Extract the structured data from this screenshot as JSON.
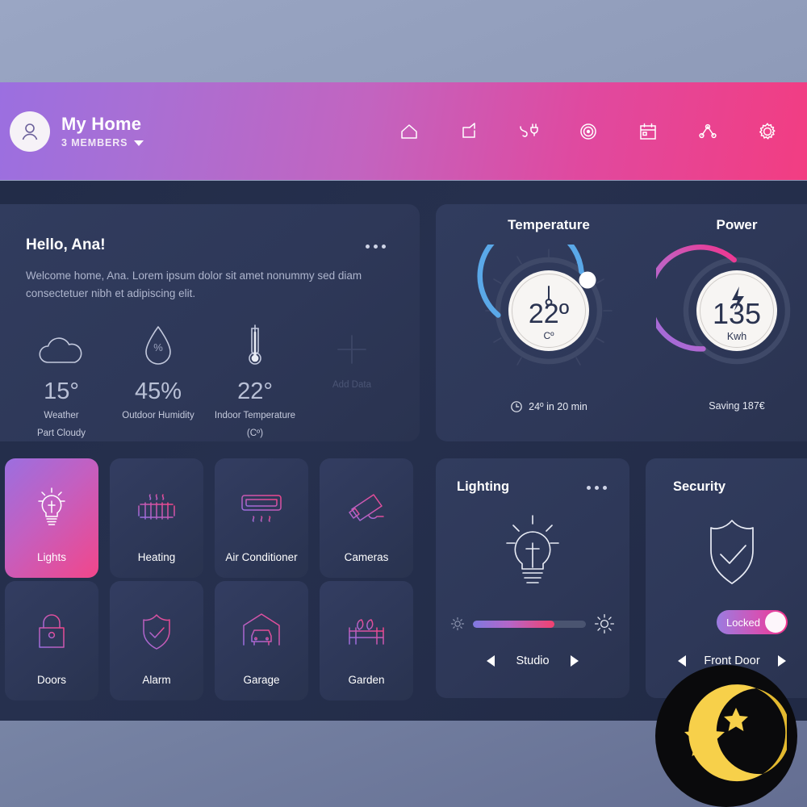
{
  "header": {
    "home_name": "My Home",
    "members": "3 MEMBERS",
    "avatar_icon": "user-avatar-icon",
    "caret_icon": "chevron-down-icon",
    "nav": [
      {
        "name": "home-icon",
        "label": "Home"
      },
      {
        "name": "share-box-icon",
        "label": "Rooms"
      },
      {
        "name": "plug-icon",
        "label": "Devices"
      },
      {
        "name": "target-icon",
        "label": "Scenes"
      },
      {
        "name": "calendar-icon",
        "label": "Schedule"
      },
      {
        "name": "network-nodes-icon",
        "label": "Automation"
      },
      {
        "name": "gear-icon",
        "label": "Settings"
      }
    ],
    "gradient_from": "#9b6fe0",
    "gradient_to": "#f23d82"
  },
  "hello": {
    "title": "Hello, Ana!",
    "body": "Welcome home, Ana. Lorem ipsum dolor sit amet nonummy sed diam consectetuer nibh et adipiscing elit.",
    "menu_icon": "more-options-icon",
    "stats": [
      {
        "icon": "cloud-icon",
        "value": "15°",
        "label": "Weather",
        "label2": "Part Cloudy"
      },
      {
        "icon": "humidity-drop-icon",
        "value": "45%",
        "label": "Outdoor Humidity",
        "label2": ""
      },
      {
        "icon": "thermometer-icon",
        "value": "22°",
        "label": "Indoor Temperature",
        "label2": "(Cº)"
      },
      {
        "icon": "plus-icon",
        "value": "",
        "label": "Add Data",
        "label2": ""
      }
    ]
  },
  "gauges": {
    "temperature": {
      "title": "Temperature",
      "value": "22º",
      "unit": "Cº",
      "footer": "24º in 20 min",
      "footer_icon": "clock-icon",
      "dial_icon": "thermometer-needle-icon",
      "arc_color": "#58a9e8",
      "percent": 72
    },
    "power": {
      "title": "Power",
      "value": "135",
      "unit": "Kwh",
      "footer": "Saving 187€",
      "dial_icon": "lightning-bolt-icon",
      "arc_from": "#9b6fe0",
      "arc_to": "#f2338c",
      "percent": 58
    }
  },
  "tiles": [
    {
      "label": "Lights",
      "icon": "lightbulb-icon",
      "active": true
    },
    {
      "label": "Heating",
      "icon": "radiator-icon",
      "active": false
    },
    {
      "label": "Air Conditioner",
      "icon": "air-conditioner-icon",
      "active": false
    },
    {
      "label": "Cameras",
      "icon": "security-camera-icon",
      "active": false
    },
    {
      "label": "Doors",
      "icon": "padlock-icon",
      "active": false
    },
    {
      "label": "Alarm",
      "icon": "shield-check-icon",
      "active": false
    },
    {
      "label": "Garage",
      "icon": "garage-car-icon",
      "active": false
    },
    {
      "label": "Garden",
      "icon": "garden-fence-icon",
      "active": false
    }
  ],
  "lighting": {
    "title": "Lighting",
    "menu_icon": "more-options-icon",
    "bulb_icon": "lightbulb-icon",
    "brightness_percent": 72,
    "low_icon": "brightness-low-icon",
    "high_icon": "brightness-high-icon",
    "room": "Studio",
    "prev_icon": "arrow-left-icon",
    "next_icon": "arrow-right-icon"
  },
  "security": {
    "title": "Security",
    "shield_icon": "shield-check-icon",
    "toggle_label": "Locked",
    "toggle_on": true,
    "device": "Front Door",
    "prev_icon": "arrow-left-icon",
    "next_icon": "arrow-right-icon"
  },
  "night_badge": {
    "icon": "crescent-moon-stars-icon",
    "moon_color": "#f7d04a",
    "bg_color": "#0a0a0c"
  }
}
